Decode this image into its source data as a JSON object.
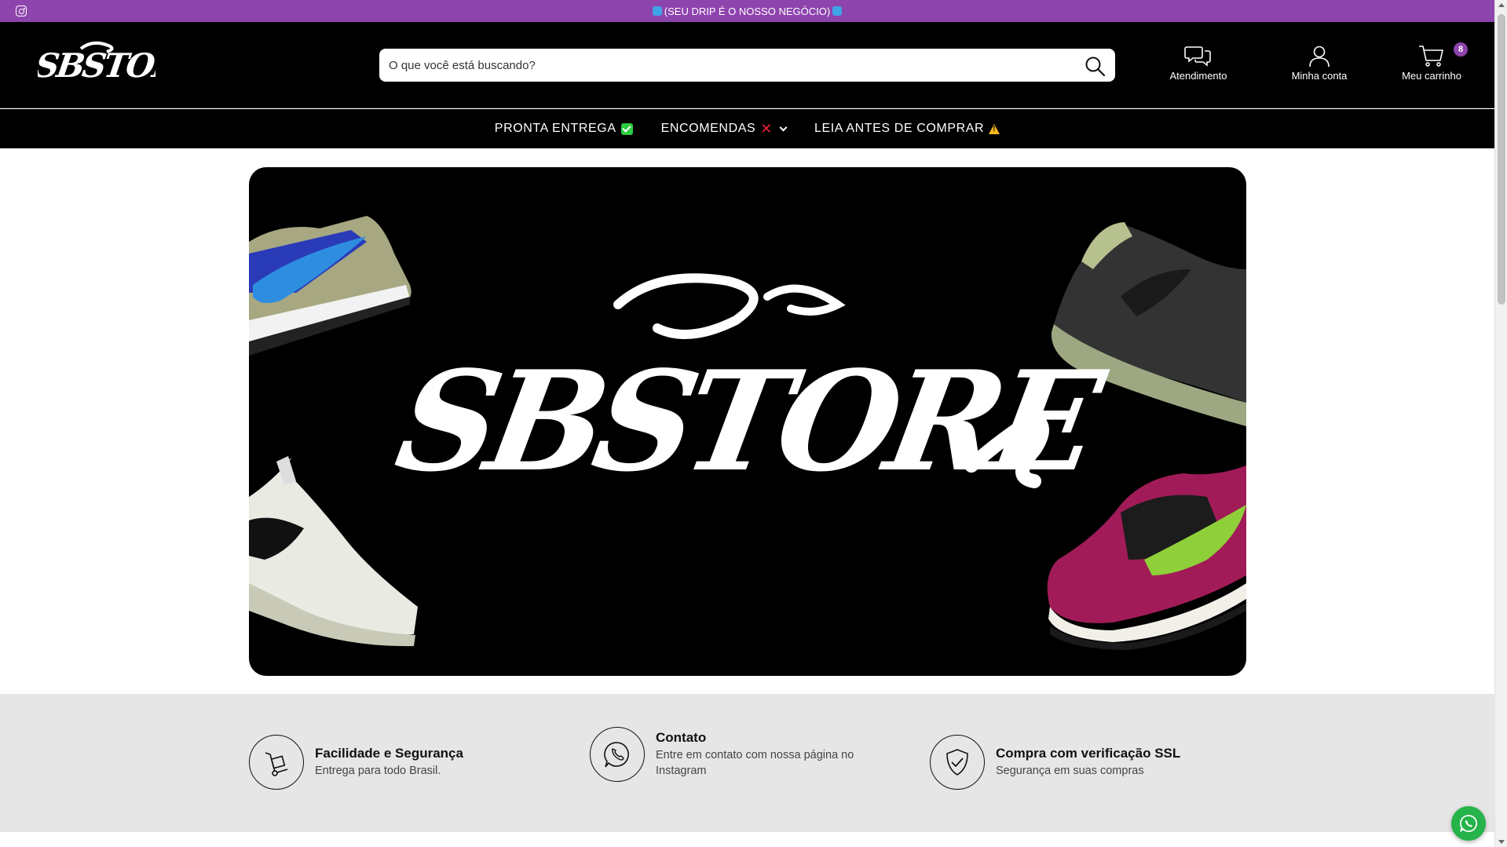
{
  "announcement": {
    "text": "(SEU DRIP É O NOSSO NEGÓCIO)",
    "social_icon": "instagram-icon",
    "bar_color": "#8e44ad"
  },
  "header": {
    "logo_text": "SBSTORE",
    "search": {
      "placeholder": "O que você está buscando?"
    },
    "items": [
      {
        "label": "Atendimento",
        "icon": "chat-icon"
      },
      {
        "label": "Minha conta",
        "icon": "user-icon"
      },
      {
        "label": "Meu carrinho",
        "icon": "cart-icon"
      }
    ],
    "cart_count": "8"
  },
  "nav": {
    "items": [
      {
        "label": "PRONTA ENTREGA",
        "emoji": "check-mark-emoji"
      },
      {
        "label": "ENCOMENDAS",
        "emoji": "cross-mark-emoji",
        "has_dropdown": true
      },
      {
        "label": "LEIA ANTES DE COMPRAR",
        "emoji": "warning-emoji"
      }
    ]
  },
  "banner": {
    "logo_text": "SBSTORE",
    "images": [
      "blue-olive-dunk-sneaker",
      "white-air-max-sneaker",
      "black-terrascape-sneaker",
      "pink-green-dunk-sneaker"
    ]
  },
  "features": [
    {
      "title": "Facilidade e Segurança",
      "desc": "Entrega para todo Brasil.",
      "icon": "hand-truck-icon"
    },
    {
      "title": "Contato",
      "desc": "Entre em contato com nossa página no Instagram",
      "icon": "whatsapp-icon"
    },
    {
      "title": "Compra com verificação SSL",
      "desc": "Segurança em suas compras",
      "icon": "shield-check-icon"
    }
  ],
  "floating": {
    "icon": "whatsapp-icon",
    "color": "#25b34a"
  }
}
